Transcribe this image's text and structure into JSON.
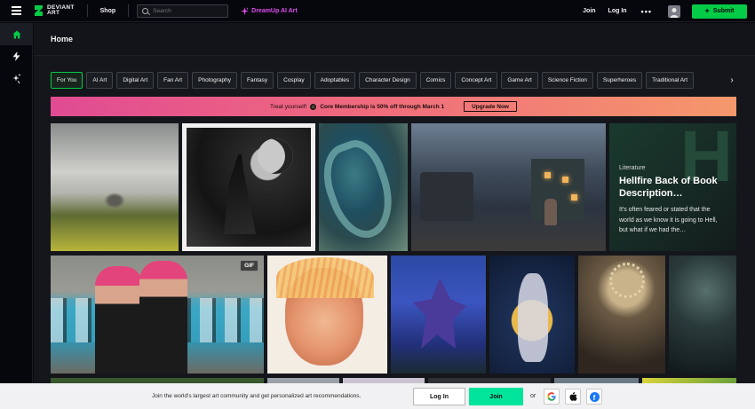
{
  "header": {
    "logo_line1": "DEVIANT",
    "logo_line2": "ART",
    "shop_label": "Shop",
    "search_placeholder": "Search",
    "dreamup_label": "DreamUp AI Art",
    "join_label": "Join",
    "login_label": "Log In",
    "more_label": "•••",
    "submit_label": "Submit",
    "accent_color": "#05cc47",
    "dreamup_color": "#e04cf0"
  },
  "sidebar": {
    "items": [
      {
        "icon": "home-icon",
        "active": true
      },
      {
        "icon": "lightning-icon",
        "active": false
      },
      {
        "icon": "dreamup-star-icon",
        "active": false
      }
    ]
  },
  "page": {
    "title": "Home"
  },
  "categories": [
    {
      "label": "For You",
      "active": true
    },
    {
      "label": "AI Art"
    },
    {
      "label": "Digital Art"
    },
    {
      "label": "Fan Art"
    },
    {
      "label": "Photography"
    },
    {
      "label": "Fantasy"
    },
    {
      "label": "Cosplay"
    },
    {
      "label": "Adoptables"
    },
    {
      "label": "Character Design"
    },
    {
      "label": "Comics"
    },
    {
      "label": "Concept Art"
    },
    {
      "label": "Game Art"
    },
    {
      "label": "Science Fiction"
    },
    {
      "label": "Superheroes"
    },
    {
      "label": "Traditional Art"
    }
  ],
  "promo": {
    "lead": "Treat yourself!",
    "offer": "Core Membership is 50% off through March 1",
    "button_label": "Upgrade Now",
    "badge": "C"
  },
  "gallery": {
    "literature": {
      "category": "Literature",
      "title": "Hellfire Back of Book Description…",
      "excerpt": "It's often feared or stated that the world as we know it is going to Hell, but what if we had the…",
      "watermark": "H"
    },
    "gif_badge": "GIF"
  },
  "signup_bar": {
    "text": "Join the world's largest art community and get personalized art recommendations.",
    "login_label": "Log In",
    "join_label": "Join",
    "or_label": "or",
    "providers": [
      "google-icon",
      "apple-icon",
      "facebook-icon"
    ]
  }
}
